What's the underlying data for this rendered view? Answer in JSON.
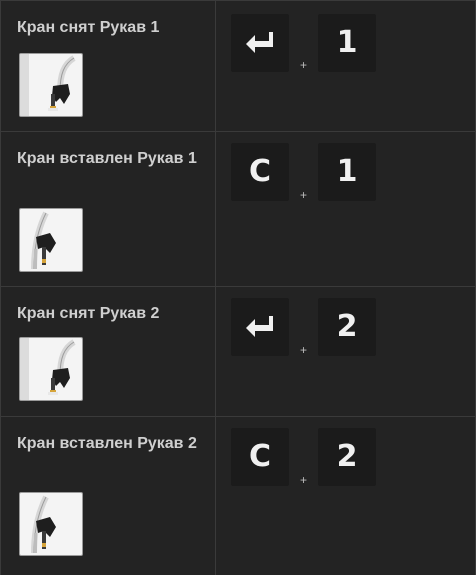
{
  "rows": [
    {
      "title": "Кран снят Рукав 1",
      "icon": "nozzle-removed-icon",
      "key1": "",
      "key1_icon": "enter-key-icon",
      "plus": "+",
      "key2": "1"
    },
    {
      "title": "Кран вставлен Рукав 1",
      "icon": "nozzle-inserted-icon",
      "key1": "C",
      "plus": "+",
      "key2": "1"
    },
    {
      "title": "Кран снят Рукав 2",
      "icon": "nozzle-removed-icon",
      "key1": "",
      "key1_icon": "enter-key-icon",
      "plus": "+",
      "key2": "2"
    },
    {
      "title": "Кран вставлен Рукав 2",
      "icon": "nozzle-inserted-icon",
      "key1": "C",
      "plus": "+",
      "key2": "2"
    }
  ],
  "colors": {
    "background": "#232323",
    "key_background": "#1b1b1b",
    "text": "#cfcfcf",
    "grid_line": "#3a3a3a"
  }
}
